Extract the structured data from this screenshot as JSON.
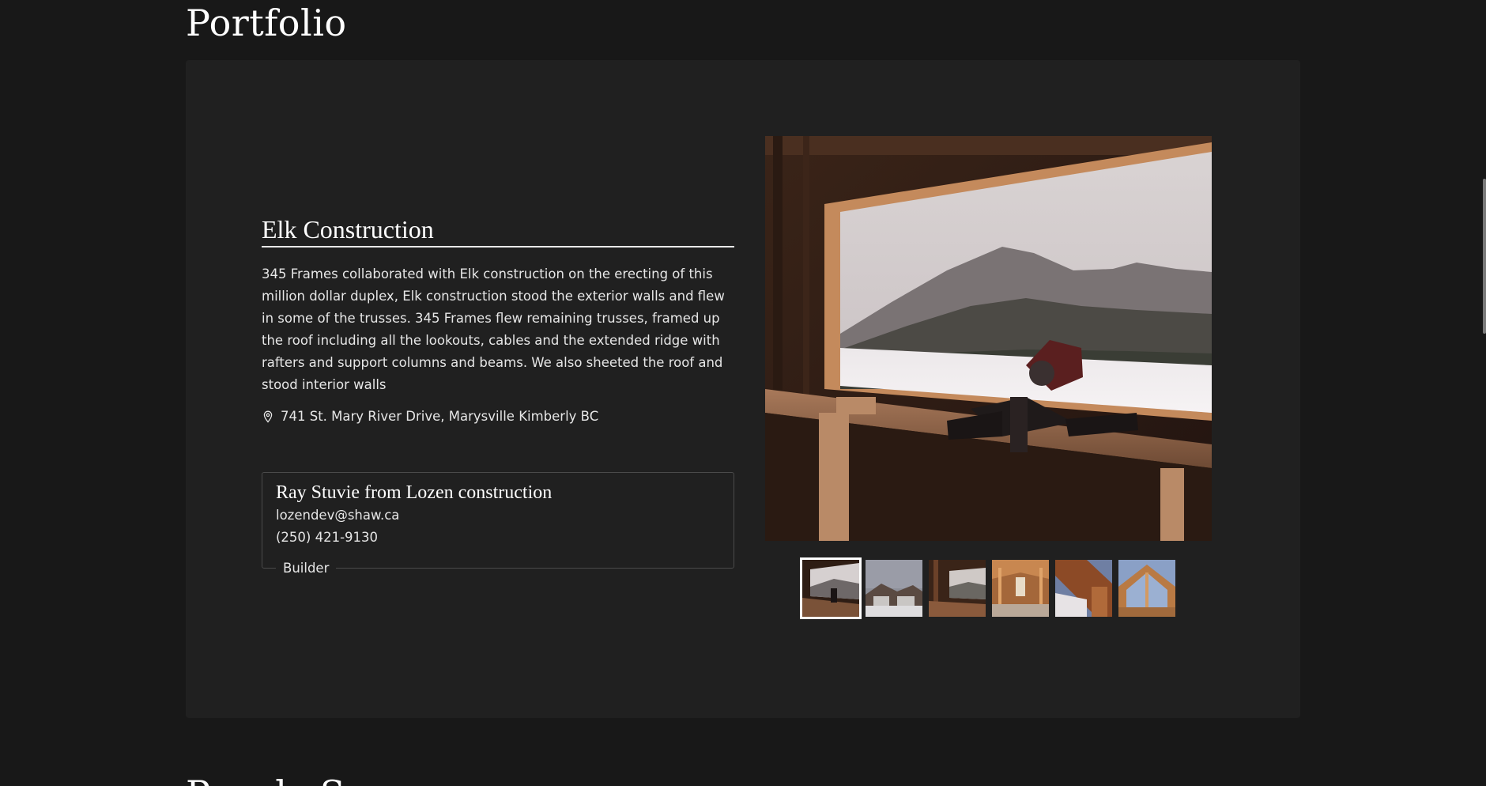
{
  "section": {
    "title": "Portfolio",
    "next_title": "People Say"
  },
  "project": {
    "title": "Elk Construction",
    "description": "345 Frames collaborated with Elk construction on the erecting of this million dollar duplex, Elk construction stood the exterior walls and flew in some of the trusses. 345 Frames flew remaining trusses, framed up the roof including all the lookouts, cables and the extended ridge with rafters and support columns and beams. We also sheeted the roof and stood interior walls",
    "location_icon": "map-pin-icon",
    "address": "741 St. Mary River Drive, Marysville Kimberly BC"
  },
  "contact": {
    "name": "Ray Stuvie from Lozen construction",
    "email": "lozendev@shaw.ca",
    "phone": "(250) 421-9130",
    "role": "Builder"
  },
  "gallery": {
    "main_photo": "window-view-mountain-miter-saw",
    "thumbnails": [
      {
        "subject": "window-view-mountain-miter-saw",
        "active": true
      },
      {
        "subject": "duplex-exterior-winter",
        "active": false
      },
      {
        "subject": "framed-window-view",
        "active": false
      },
      {
        "subject": "interior-framing-roof",
        "active": false
      },
      {
        "subject": "roof-trusses-sky",
        "active": false
      },
      {
        "subject": "gable-truss-sky",
        "active": false
      }
    ]
  },
  "colors": {
    "background": "#181818",
    "card": "#202020",
    "text": "#e6e6e6",
    "heading": "#ffffff"
  }
}
